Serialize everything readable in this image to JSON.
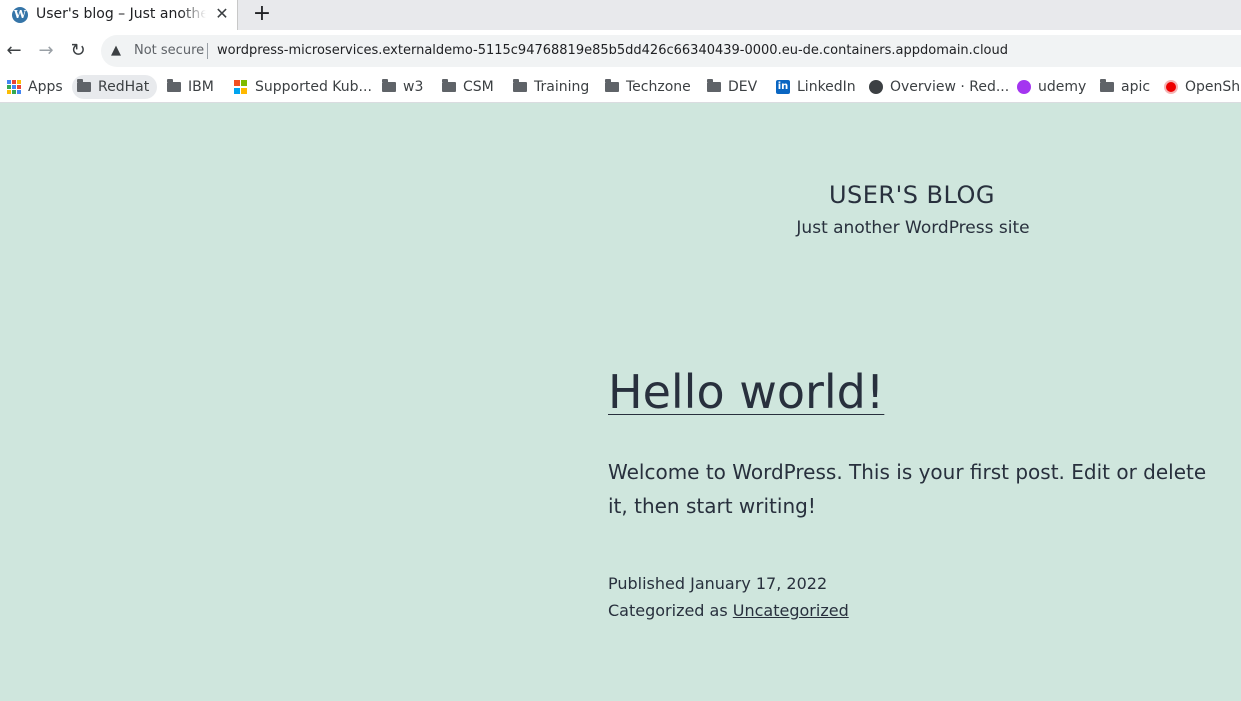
{
  "browser": {
    "tab": {
      "title": "User's blog – Just another WordPress site",
      "icon": "wordpress-icon"
    },
    "toolbar": {
      "security_label": "Not secure",
      "url": "wordpress-microservices.externaldemo-5115c94768819e85b5dd426c66340439-0000.eu-de.containers.appdomain.cloud"
    },
    "bookmarks": [
      {
        "label": "Apps",
        "icon": "apps-grid-icon"
      },
      {
        "label": "RedHat",
        "icon": "folder-icon"
      },
      {
        "label": "IBM",
        "icon": "folder-icon"
      },
      {
        "label": "Supported Kub...",
        "icon": "microsoft-icon"
      },
      {
        "label": "w3",
        "icon": "folder-icon"
      },
      {
        "label": "CSM",
        "icon": "folder-icon"
      },
      {
        "label": "Training",
        "icon": "folder-icon"
      },
      {
        "label": "Techzone",
        "icon": "folder-icon"
      },
      {
        "label": "DEV",
        "icon": "folder-icon"
      },
      {
        "label": "LinkedIn",
        "icon": "linkedin-icon"
      },
      {
        "label": "Overview · Red...",
        "icon": "globe-icon"
      },
      {
        "label": "udemy",
        "icon": "udemy-icon"
      },
      {
        "label": "apic",
        "icon": "folder-icon"
      },
      {
        "label": "OpenShi",
        "icon": "openshift-icon"
      }
    ]
  },
  "site": {
    "title": "USER'S BLOG",
    "tagline": "Just another WordPress site",
    "background_color": "#cfe6dd",
    "text_color": "#28303d"
  },
  "post": {
    "title": "Hello world!",
    "body": "Welcome to WordPress. This is your first post. Edit or delete it, then start writing!",
    "published_label": "Published",
    "published_date": "January 17, 2022",
    "category_label": "Categorized as",
    "category": "Uncategorized"
  }
}
